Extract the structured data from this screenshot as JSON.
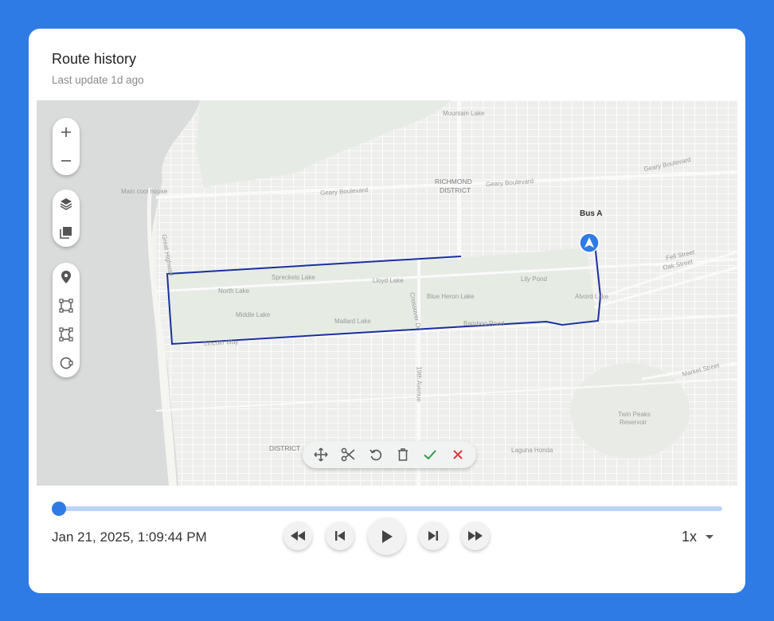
{
  "header": {
    "title": "Route history",
    "subtitle": "Last update 1d ago"
  },
  "map": {
    "labels": {
      "mountain_lake": "Mountain Lake",
      "richmond_1": "RICHMOND",
      "richmond_2": "DISTRICT",
      "geary_1": "Geary Boulevard",
      "geary_2": "Geary Boulevard",
      "geary_3": "Geary Boulevard",
      "cliff_house": "Main cool house",
      "great_highway": "Great Highway",
      "spreckels": "Spreckels Lake",
      "lloyd": "Lloyd Lake",
      "lily": "Lily Pond",
      "north_lake": "North Lake",
      "blue_heron": "Blue Heron Lake",
      "alvord": "Alvord Lake",
      "middle_lake": "Middle Lake",
      "mallard": "Mallard Lake",
      "bamboo": "Bamboo Road",
      "lincoln": "Lincoln Way",
      "crossover": "Crossover Dr",
      "fell": "Fell Street",
      "oak": "Oak Street",
      "market": "Market Street",
      "nineteenth": "19th Avenue",
      "twin_peaks_1": "Twin Peaks",
      "twin_peaks_2": "Reservoir",
      "laguna": "Laguna Honda",
      "district": "DISTRICT"
    },
    "vehicle_label": "Bus A",
    "accent_color": "#2f7be6",
    "route_color": "#1a2fa0"
  },
  "map_controls": {
    "zoom_in": "plus-icon",
    "zoom_out": "minus-icon",
    "layers": "layers-icon",
    "basemap": "gallery-icon",
    "marker": "pin-icon",
    "rectangle": "rectangle-icon",
    "polygon": "polygon-icon",
    "circle": "circle-icon"
  },
  "edit_toolbar": [
    "move-icon",
    "cut-icon",
    "rotate-icon",
    "delete-icon",
    "confirm-icon",
    "cancel-icon"
  ],
  "playback": {
    "progress": 0.0,
    "timestamp": "Jan 21, 2025, 1:09:44 PM",
    "speed": "1x"
  }
}
